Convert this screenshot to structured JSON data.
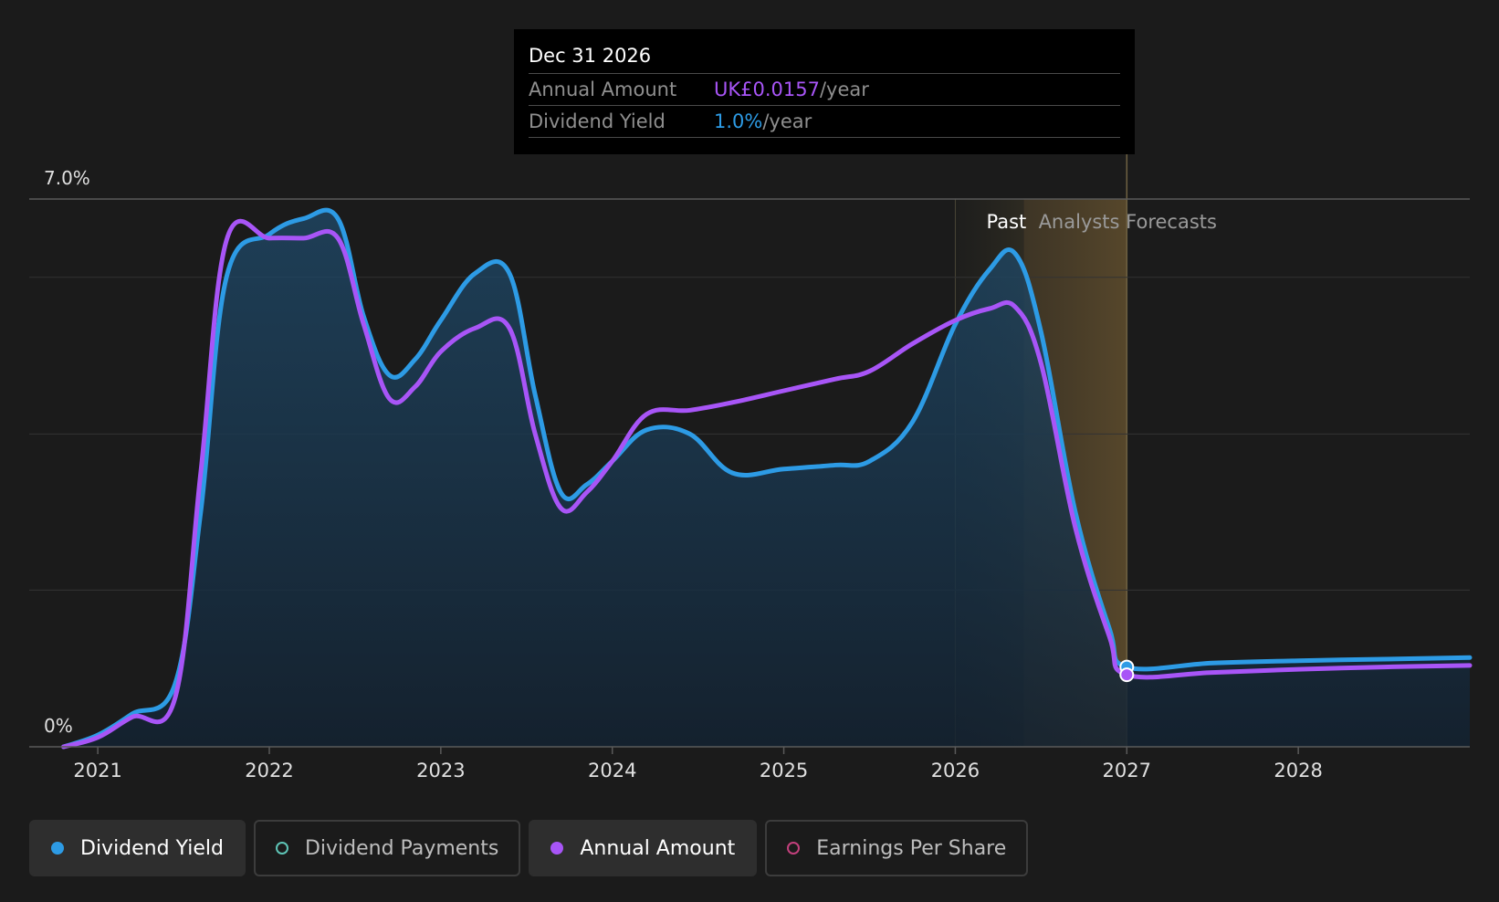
{
  "tooltip": {
    "date": "Dec 31 2026",
    "rows": [
      {
        "label": "Annual Amount",
        "value": "UK£0.0157",
        "unit": "/year",
        "color": "#a855f7"
      },
      {
        "label": "Dividend Yield",
        "value": "1.0%",
        "unit": "/year",
        "color": "#2d9be5"
      }
    ]
  },
  "legend": [
    {
      "label": "Dividend Yield",
      "color": "#2d9be5",
      "filled": true,
      "active": true
    },
    {
      "label": "Dividend Payments",
      "color": "#5ec4b6",
      "filled": false,
      "active": false
    },
    {
      "label": "Annual Amount",
      "color": "#a855f7",
      "filled": true,
      "active": true
    },
    {
      "label": "Earnings Per Share",
      "color": "#c2407c",
      "filled": false,
      "active": false
    }
  ],
  "chart_data": {
    "type": "line",
    "title": "",
    "xlabel": "",
    "ylabel": "",
    "y_tick_labels": [
      "7.0%",
      "0%"
    ],
    "ylim": [
      0,
      7.0
    ],
    "xlim": [
      2020.6,
      2029.0
    ],
    "x_ticks": [
      2021,
      2022,
      2023,
      2024,
      2025,
      2026,
      2027,
      2028
    ],
    "grid": true,
    "legend_position": "bottom",
    "regions": [
      {
        "label": "Past",
        "from": 2026.0,
        "to": 2026.4
      },
      {
        "label": "Analysts Forecasts",
        "from": 2026.4,
        "to": 2027.0
      }
    ],
    "cursor_x": 2027.0,
    "series": [
      {
        "name": "Dividend Yield",
        "color": "#2d9be5",
        "area": true,
        "x": [
          2020.8,
          2021.0,
          2021.2,
          2021.45,
          2021.6,
          2021.75,
          2022.0,
          2022.2,
          2022.4,
          2022.55,
          2022.7,
          2022.85,
          2023.0,
          2023.2,
          2023.4,
          2023.55,
          2023.7,
          2023.85,
          2024.0,
          2024.2,
          2024.45,
          2024.7,
          2025.0,
          2025.3,
          2025.5,
          2025.75,
          2026.0,
          2026.2,
          2026.35,
          2026.5,
          2026.7,
          2026.9,
          2027.0,
          2027.5,
          2028.0,
          2028.5,
          2029.0
        ],
        "values": [
          0.0,
          0.15,
          0.42,
          0.8,
          3.0,
          6.0,
          6.55,
          6.75,
          6.75,
          5.5,
          4.75,
          4.95,
          5.45,
          6.05,
          6.05,
          4.5,
          3.25,
          3.35,
          3.65,
          4.05,
          4.0,
          3.5,
          3.55,
          3.6,
          3.65,
          4.15,
          5.4,
          6.1,
          6.3,
          5.3,
          3.0,
          1.5,
          1.02,
          1.07,
          1.1,
          1.12,
          1.14
        ]
      },
      {
        "name": "Annual Amount",
        "color": "#a855f7",
        "area": false,
        "x": [
          2020.8,
          2021.0,
          2021.2,
          2021.45,
          2021.6,
          2021.75,
          2022.0,
          2022.2,
          2022.4,
          2022.55,
          2022.7,
          2022.85,
          2023.0,
          2023.2,
          2023.4,
          2023.55,
          2023.7,
          2023.85,
          2024.0,
          2024.2,
          2024.45,
          2024.7,
          2025.0,
          2025.3,
          2025.5,
          2025.75,
          2026.0,
          2026.2,
          2026.35,
          2026.5,
          2026.7,
          2026.9,
          2027.0,
          2027.5,
          2028.0,
          2028.5,
          2029.0
        ],
        "values": [
          0.0,
          0.12,
          0.38,
          0.62,
          3.5,
          6.47,
          6.5,
          6.5,
          6.5,
          5.4,
          4.45,
          4.6,
          5.05,
          5.35,
          5.35,
          4.0,
          3.05,
          3.25,
          3.65,
          4.25,
          4.3,
          4.4,
          4.55,
          4.7,
          4.8,
          5.15,
          5.45,
          5.6,
          5.62,
          4.9,
          2.8,
          1.4,
          0.92,
          0.95,
          0.99,
          1.02,
          1.04
        ]
      }
    ]
  }
}
